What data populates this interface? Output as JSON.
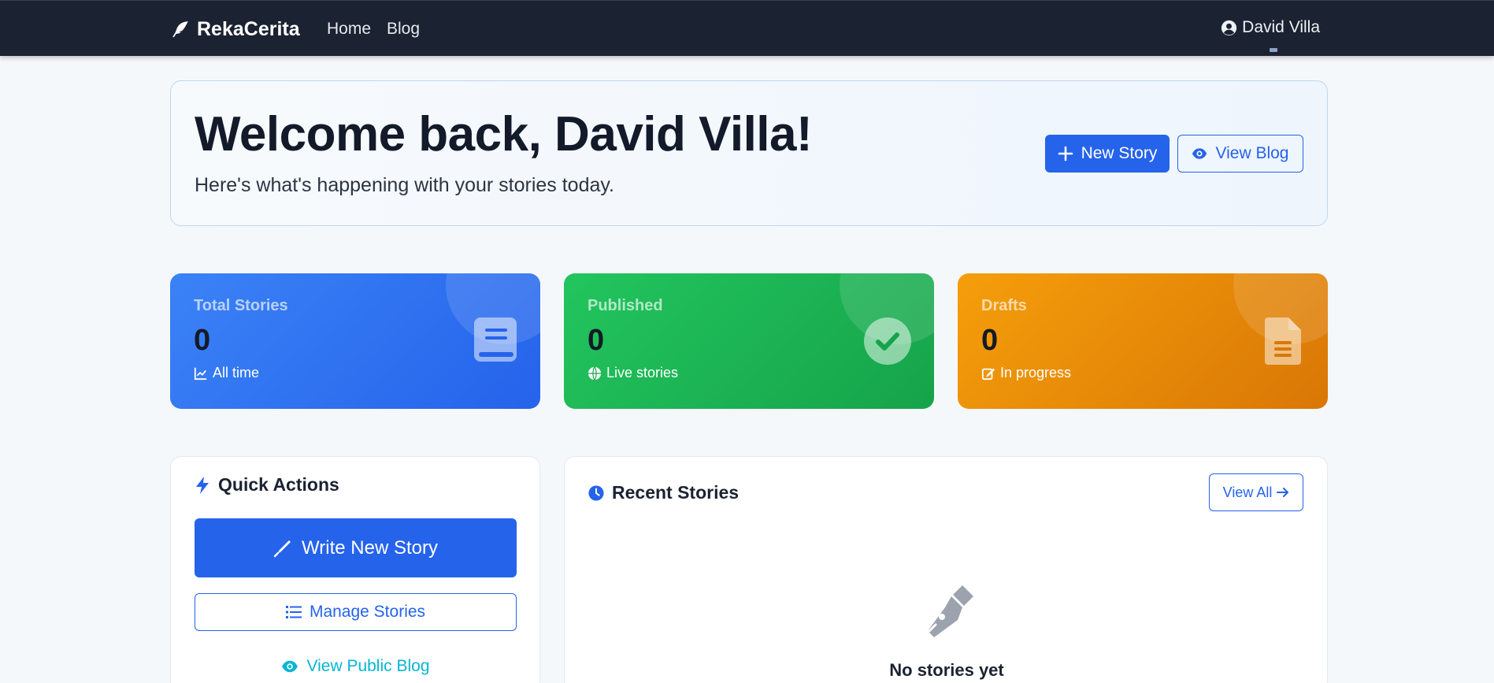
{
  "navbar": {
    "brand": "RekaCerita",
    "links": [
      "Home",
      "Blog"
    ],
    "user_name": "David Villa"
  },
  "welcome": {
    "title": "Welcome back, David Villa!",
    "subtitle": "Here's what's happening with your stories today.",
    "new_story_label": "New Story",
    "view_blog_label": "View Blog"
  },
  "stats": [
    {
      "label": "Total Stories",
      "value": "0",
      "sub": "All time",
      "icon": "book-icon",
      "color": "#2563eb"
    },
    {
      "label": "Published",
      "value": "0",
      "sub": "Live stories",
      "icon": "check-circle-icon",
      "color": "#16a34a"
    },
    {
      "label": "Drafts",
      "value": "0",
      "sub": "In progress",
      "icon": "file-icon",
      "color": "#d97706"
    }
  ],
  "quick_actions": {
    "title": "Quick Actions",
    "write_label": "Write New Story",
    "manage_label": "Manage Stories",
    "public_label": "View Public Blog"
  },
  "recent_stories": {
    "title": "Recent Stories",
    "view_all_label": "View All",
    "empty_text": "No stories yet"
  },
  "colors": {
    "primary": "#2563eb",
    "navbar": "#1b2231",
    "info": "#06b6d4"
  }
}
